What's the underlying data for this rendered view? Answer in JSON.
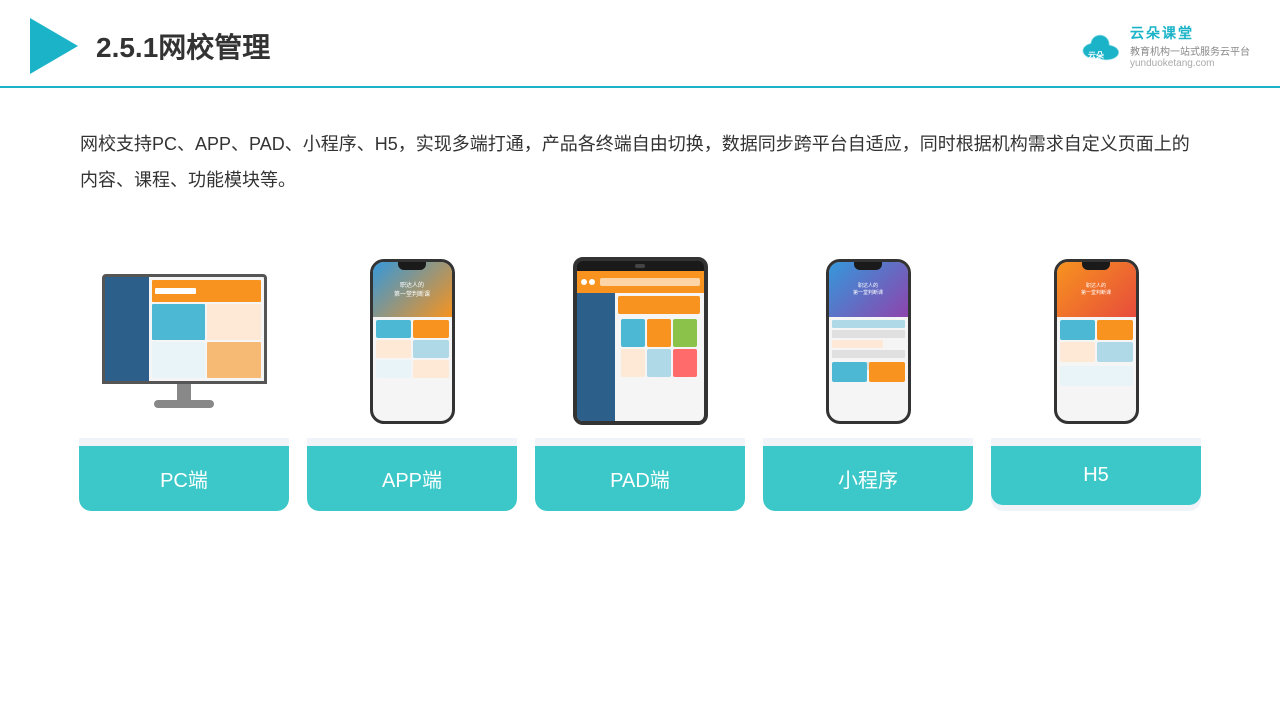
{
  "header": {
    "title": "2.5.1网校管理",
    "brand_name": "云朵课堂",
    "brand_slogan": "教育机构一站式服务云平台",
    "brand_url": "yunduoketang.com"
  },
  "description": {
    "text": "网校支持PC、APP、PAD、小程序、H5，实现多端打通，产品各终端自由切换，数据同步跨平台自适应，同时根据机构需求自定义页面上的内容、课程、功能模块等。"
  },
  "cards": [
    {
      "label": "PC端",
      "id": "pc"
    },
    {
      "label": "APP端",
      "id": "app"
    },
    {
      "label": "PAD端",
      "id": "pad"
    },
    {
      "label": "小程序",
      "id": "miniapp"
    },
    {
      "label": "H5",
      "id": "h5"
    }
  ]
}
